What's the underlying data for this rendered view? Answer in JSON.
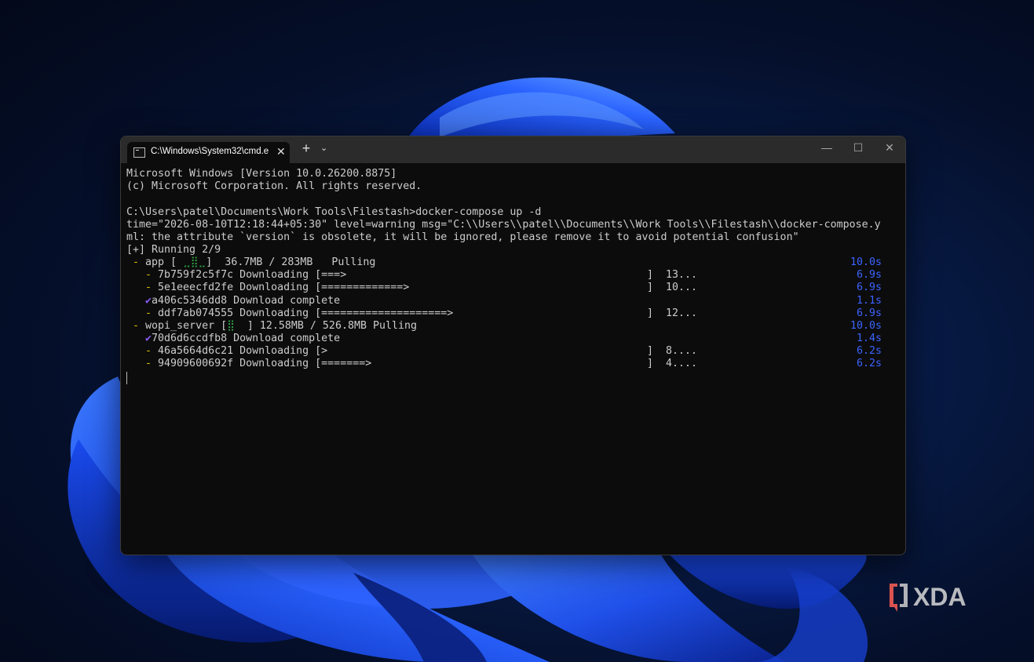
{
  "window": {
    "tab_title": "C:\\Windows\\System32\\cmd.e",
    "tab_close": "✕",
    "new_tab": "+",
    "dropdown": "⌄",
    "minimize": "—",
    "maximize": "☐",
    "close": "✕"
  },
  "console": {
    "header1": "Microsoft Windows [Version 10.0.26200.8875]",
    "header2": "(c) Microsoft Corporation. All rights reserved.",
    "prompt": "C:\\Users\\patel\\Documents\\Work Tools\\Filestash>docker-compose up -d",
    "warn1": "time=\"2026-08-10T12:18:44+05:30\" level=warning msg=\"C:\\\\Users\\\\patel\\\\Documents\\\\Work Tools\\\\Filestash\\\\docker-compose.y",
    "warn2": "ml: the attribute `version` is obsolete, it will be ignored, please remove it to avoid potential confusion\"",
    "running": "[+] Running 2/9",
    "app": {
      "dash": "-",
      "name": "app [",
      "spinner": " ⣀⣿⣀",
      "rest": "]  36.7MB / 283MB   Pulling",
      "time": "10.0s"
    },
    "layers": [
      {
        "mark": "-",
        "text": "7b759f2c5f7c Downloading [===>",
        "bracket": "]",
        "pct": "13...",
        "time": "6.9s"
      },
      {
        "mark": "-",
        "text": "5e1eeecfd2fe Downloading [=============>",
        "bracket": "]",
        "pct": "10...",
        "time": "6.9s"
      },
      {
        "mark": "✔",
        "text": "a406c5346dd8 Download complete",
        "bracket": "",
        "pct": "",
        "time": "1.1s"
      },
      {
        "mark": "-",
        "text": "ddf7ab074555 Downloading [====================>",
        "bracket": "]",
        "pct": "12...",
        "time": "6.9s"
      }
    ],
    "wopi": {
      "dash": "-",
      "name": "wopi_server [",
      "spinner": "⣿ ",
      "rest": " ] 12.58MB / 526.8MB Pulling",
      "time": "10.0s"
    },
    "layers2": [
      {
        "mark": "✔",
        "text": "70d6d6ccdfb8 Download complete",
        "bracket": "",
        "pct": "",
        "time": "1.4s"
      },
      {
        "mark": "-",
        "text": "46a5664d6c21 Downloading [>",
        "bracket": "]",
        "pct": "8....",
        "time": "6.2s"
      },
      {
        "mark": "-",
        "text": "94909600692f Downloading [=======>",
        "bracket": "]",
        "pct": "4....",
        "time": "6.2s"
      }
    ]
  },
  "watermark": {
    "text": "XDA"
  },
  "colors": {
    "wallpaper_blue": "#1f5bff",
    "terminal_bg": "#0c0c0c",
    "time_blue": "#3b64ff",
    "accent_purple": "#8a5cf6"
  }
}
